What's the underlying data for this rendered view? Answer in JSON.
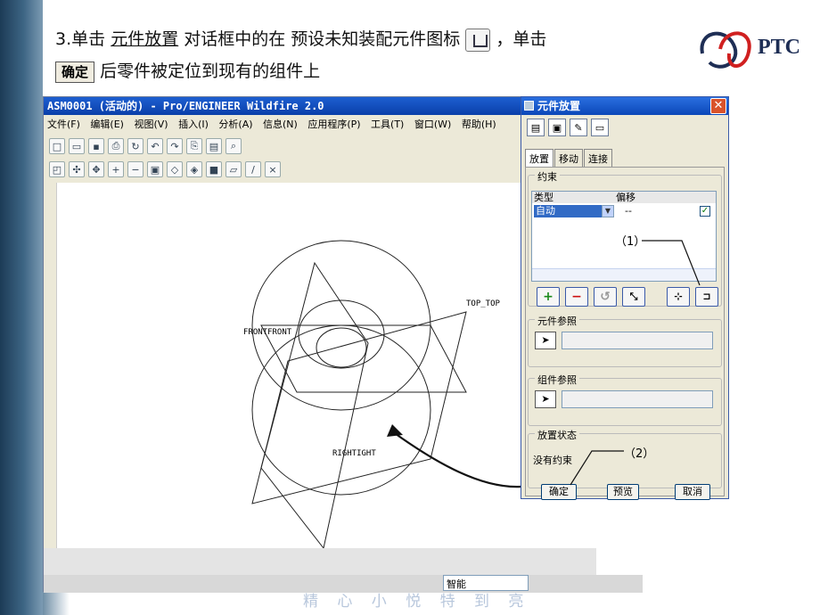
{
  "instruction": {
    "step": "3.单击",
    "link_text": "元件放置",
    "text_mid": "对话框中的在 预设未知装配元件图标",
    "text_after_icon": "，单击",
    "ok_label": "确定",
    "text_end": "后零件被定位到现有的组件上"
  },
  "logo": {
    "text": "PTC"
  },
  "app": {
    "title": "ASM0001 (活动的) - Pro/ENGINEER Wildfire 2.0",
    "menu": [
      "文件(F)",
      "编辑(E)",
      "视图(V)",
      "插入(I)",
      "分析(A)",
      "信息(N)",
      "应用程序(P)",
      "工具(T)",
      "窗口(W)",
      "帮助(H)"
    ],
    "datum_labels": {
      "top": "TOP_TOP",
      "front": "FRONTFRONT",
      "right": "RIGHTIGHT"
    },
    "status_select": "智能"
  },
  "dialog": {
    "title": "元件放置",
    "tabs": [
      "放置",
      "移动",
      "连接"
    ],
    "constraints_label": "约束",
    "col_type": "类型",
    "col_offset": "偏移",
    "row_type": "自动",
    "row_offset": "--",
    "component_ref_label": "元件参照",
    "assembly_ref_label": "组件参照",
    "status_label": "放置状态",
    "status_value": "没有约束",
    "btn_ok": "确定",
    "btn_preview": "预览",
    "btn_cancel": "取消"
  },
  "callouts": {
    "c1": "（1）",
    "c2": "（2）"
  },
  "footer_text": "精 心 小 悦      特 到 亮"
}
